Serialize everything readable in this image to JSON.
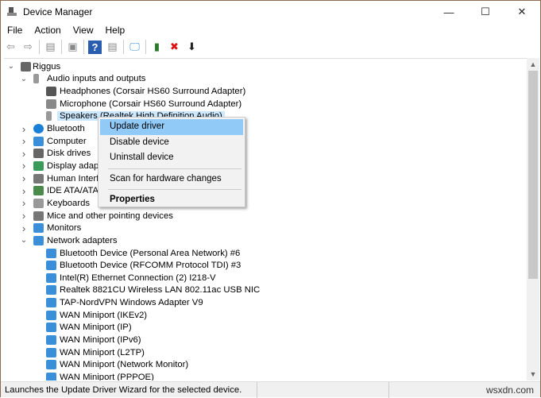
{
  "window": {
    "title": "Device Manager",
    "controls": [
      "—",
      "☐",
      "✕"
    ]
  },
  "menu": [
    "File",
    "Action",
    "View",
    "Help"
  ],
  "toolbar": [
    {
      "name": "back",
      "glyph": "⇦"
    },
    {
      "name": "forward",
      "glyph": "⇨"
    },
    {
      "name": "properties-pane",
      "glyph": "▤"
    },
    {
      "name": "properties",
      "glyph": "▣"
    },
    {
      "name": "help",
      "glyph": "?"
    },
    {
      "name": "view",
      "glyph": "▤"
    },
    {
      "name": "scan",
      "glyph": "🖵"
    },
    {
      "name": "update-driver",
      "glyph": "▮"
    },
    {
      "name": "uninstall",
      "glyph": "✖"
    },
    {
      "name": "disable",
      "glyph": "⬇"
    }
  ],
  "tree": [
    {
      "label": "Riggus",
      "level": 0,
      "expand": "open",
      "icon": "computer",
      "color": "#666"
    },
    {
      "label": "Audio inputs and outputs",
      "level": 1,
      "expand": "open",
      "icon": "speaker",
      "color": "#999"
    },
    {
      "label": "Headphones (Corsair HS60 Surround Adapter)",
      "level": 2,
      "icon": "headphones",
      "color": "#555"
    },
    {
      "label": "Microphone (Corsair HS60 Surround Adapter)",
      "level": 2,
      "icon": "microphone",
      "color": "#888"
    },
    {
      "label": "Speakers (Realtek High Definition Audio)",
      "level": 2,
      "icon": "speaker",
      "color": "#999",
      "selected": true
    },
    {
      "label": "Bluetooth",
      "level": 1,
      "expand": "closed",
      "icon": "bluetooth",
      "color": "#1a7fd6"
    },
    {
      "label": "Computer",
      "level": 1,
      "expand": "closed",
      "icon": "monitor",
      "color": "#3a8fd8"
    },
    {
      "label": "Disk drives",
      "level": 1,
      "expand": "closed",
      "icon": "disk",
      "color": "#666"
    },
    {
      "label": "Display adapters",
      "level": 1,
      "expand": "closed",
      "icon": "display-adapter",
      "color": "#3a9a5a"
    },
    {
      "label": "Human Interface Devices",
      "level": 1,
      "expand": "closed",
      "icon": "hid",
      "color": "#777"
    },
    {
      "label": "IDE ATA/ATAPI controllers",
      "level": 1,
      "expand": "closed",
      "icon": "ide",
      "color": "#4a8a4a"
    },
    {
      "label": "Keyboards",
      "level": 1,
      "expand": "closed",
      "icon": "keyboard",
      "color": "#999"
    },
    {
      "label": "Mice and other pointing devices",
      "level": 1,
      "expand": "closed",
      "icon": "mouse",
      "color": "#777"
    },
    {
      "label": "Monitors",
      "level": 1,
      "expand": "closed",
      "icon": "monitor",
      "color": "#3a8fd8"
    },
    {
      "label": "Network adapters",
      "level": 1,
      "expand": "open",
      "icon": "network",
      "color": "#3a8fd8"
    },
    {
      "label": "Bluetooth Device (Personal Area Network) #6",
      "level": 2,
      "icon": "network",
      "color": "#3a8fd8"
    },
    {
      "label": "Bluetooth Device (RFCOMM Protocol TDI) #3",
      "level": 2,
      "icon": "network",
      "color": "#3a8fd8"
    },
    {
      "label": "Intel(R) Ethernet Connection (2) I218-V",
      "level": 2,
      "icon": "network",
      "color": "#3a8fd8"
    },
    {
      "label": "Realtek 8821CU Wireless LAN 802.11ac USB NIC",
      "level": 2,
      "icon": "network",
      "color": "#3a8fd8"
    },
    {
      "label": "TAP-NordVPN Windows Adapter V9",
      "level": 2,
      "icon": "network",
      "color": "#3a8fd8"
    },
    {
      "label": "WAN Miniport (IKEv2)",
      "level": 2,
      "icon": "network",
      "color": "#3a8fd8"
    },
    {
      "label": "WAN Miniport (IP)",
      "level": 2,
      "icon": "network",
      "color": "#3a8fd8"
    },
    {
      "label": "WAN Miniport (IPv6)",
      "level": 2,
      "icon": "network",
      "color": "#3a8fd8"
    },
    {
      "label": "WAN Miniport (L2TP)",
      "level": 2,
      "icon": "network",
      "color": "#3a8fd8"
    },
    {
      "label": "WAN Miniport (Network Monitor)",
      "level": 2,
      "icon": "network",
      "color": "#3a8fd8"
    },
    {
      "label": "WAN Miniport (PPPOE)",
      "level": 2,
      "icon": "network",
      "color": "#3a8fd8"
    }
  ],
  "context_menu": [
    {
      "label": "Update driver",
      "highlighted": true
    },
    {
      "label": "Disable device"
    },
    {
      "label": "Uninstall device"
    },
    {
      "separator": true
    },
    {
      "label": "Scan for hardware changes"
    },
    {
      "separator": true
    },
    {
      "label": "Properties",
      "bold": true
    }
  ],
  "status": {
    "text": "Launches the Update Driver Wizard for the selected device.",
    "watermark": "wsxdn.com"
  }
}
